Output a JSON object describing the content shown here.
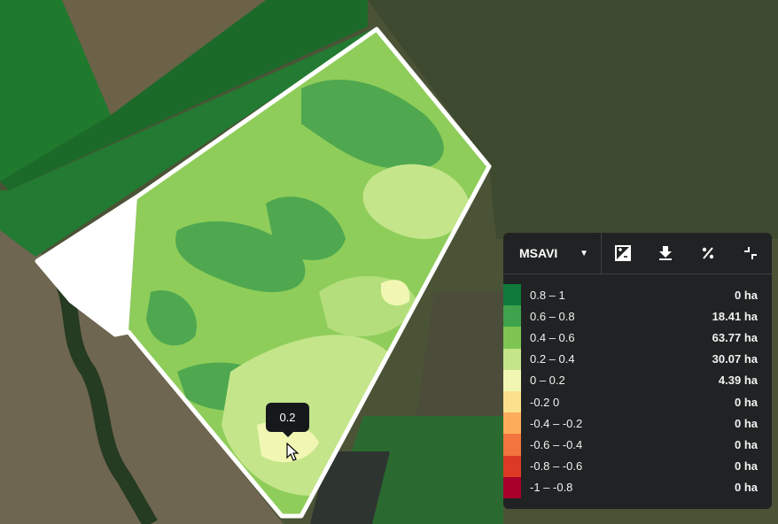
{
  "map": {
    "tooltip_value": "0.2"
  },
  "panel": {
    "layer_label": "MSAVI",
    "tools": [
      {
        "icon": "image-compare-icon"
      },
      {
        "icon": "download-icon"
      },
      {
        "icon": "percent-icon"
      },
      {
        "icon": "collapse-icon"
      }
    ],
    "legend": [
      {
        "range": "0.8 – 1",
        "area": "0 ha",
        "color": "#0f7a3c"
      },
      {
        "range": "0.6 – 0.8",
        "area": "18.41 ha",
        "color": "#3ea34c"
      },
      {
        "range": "0.4 – 0.6",
        "area": "63.77 ha",
        "color": "#7fc553"
      },
      {
        "range": "0.2 – 0.4",
        "area": "30.07 ha",
        "color": "#c4e58a"
      },
      {
        "range": "0 – 0.2",
        "area": "4.39 ha",
        "color": "#f1f7b3"
      },
      {
        "range": "-0.2 0",
        "area": "0 ha",
        "color": "#fde08c"
      },
      {
        "range": "-0.4 – -0.2",
        "area": "0 ha",
        "color": "#fbad5b"
      },
      {
        "range": "-0.6 – -0.4",
        "area": "0 ha",
        "color": "#f2743e"
      },
      {
        "range": "-0.8 – -0.6",
        "area": "0 ha",
        "color": "#dc3a24"
      },
      {
        "range": "-1 – -0.8",
        "area": "0 ha",
        "color": "#a8002a"
      }
    ]
  }
}
